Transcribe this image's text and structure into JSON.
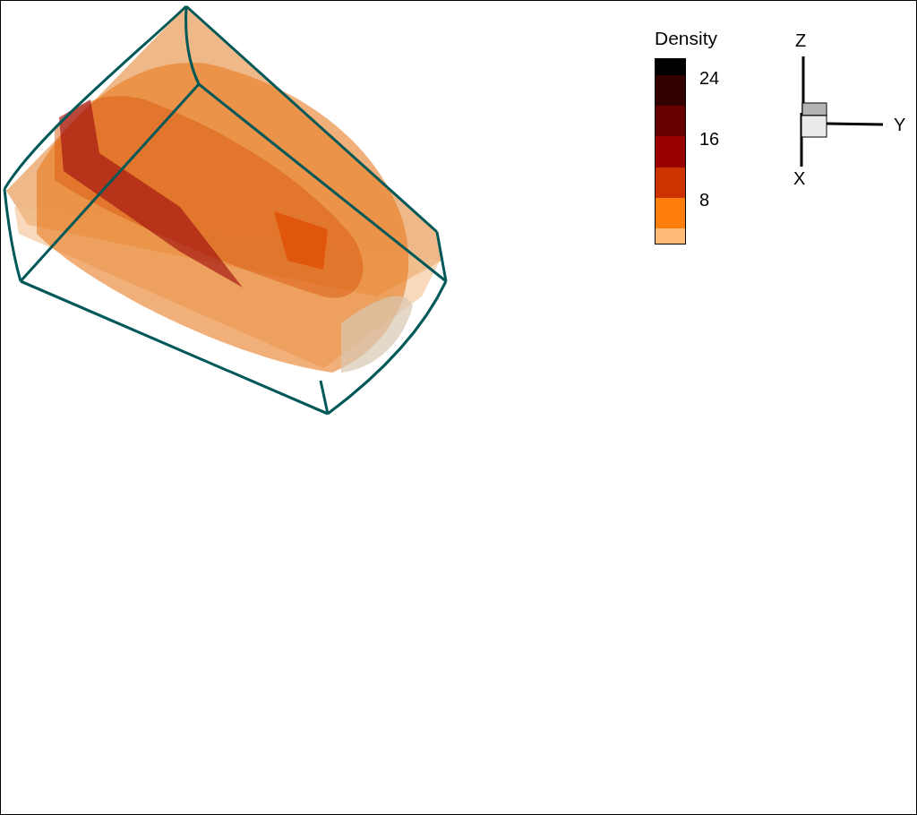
{
  "plot": {
    "legend": {
      "title": "Density",
      "bands": [
        {
          "color": "#000000"
        },
        {
          "color": "#330000"
        },
        {
          "color": "#660000"
        },
        {
          "color": "#990000"
        },
        {
          "color": "#cc3300"
        },
        {
          "color": "#ff7f0e"
        },
        {
          "color": "#ffbb77"
        }
      ],
      "labels": [
        "24",
        "16",
        "8"
      ]
    },
    "axes": {
      "z_label": "Z",
      "y_label": "Y",
      "x_label": "X"
    }
  }
}
